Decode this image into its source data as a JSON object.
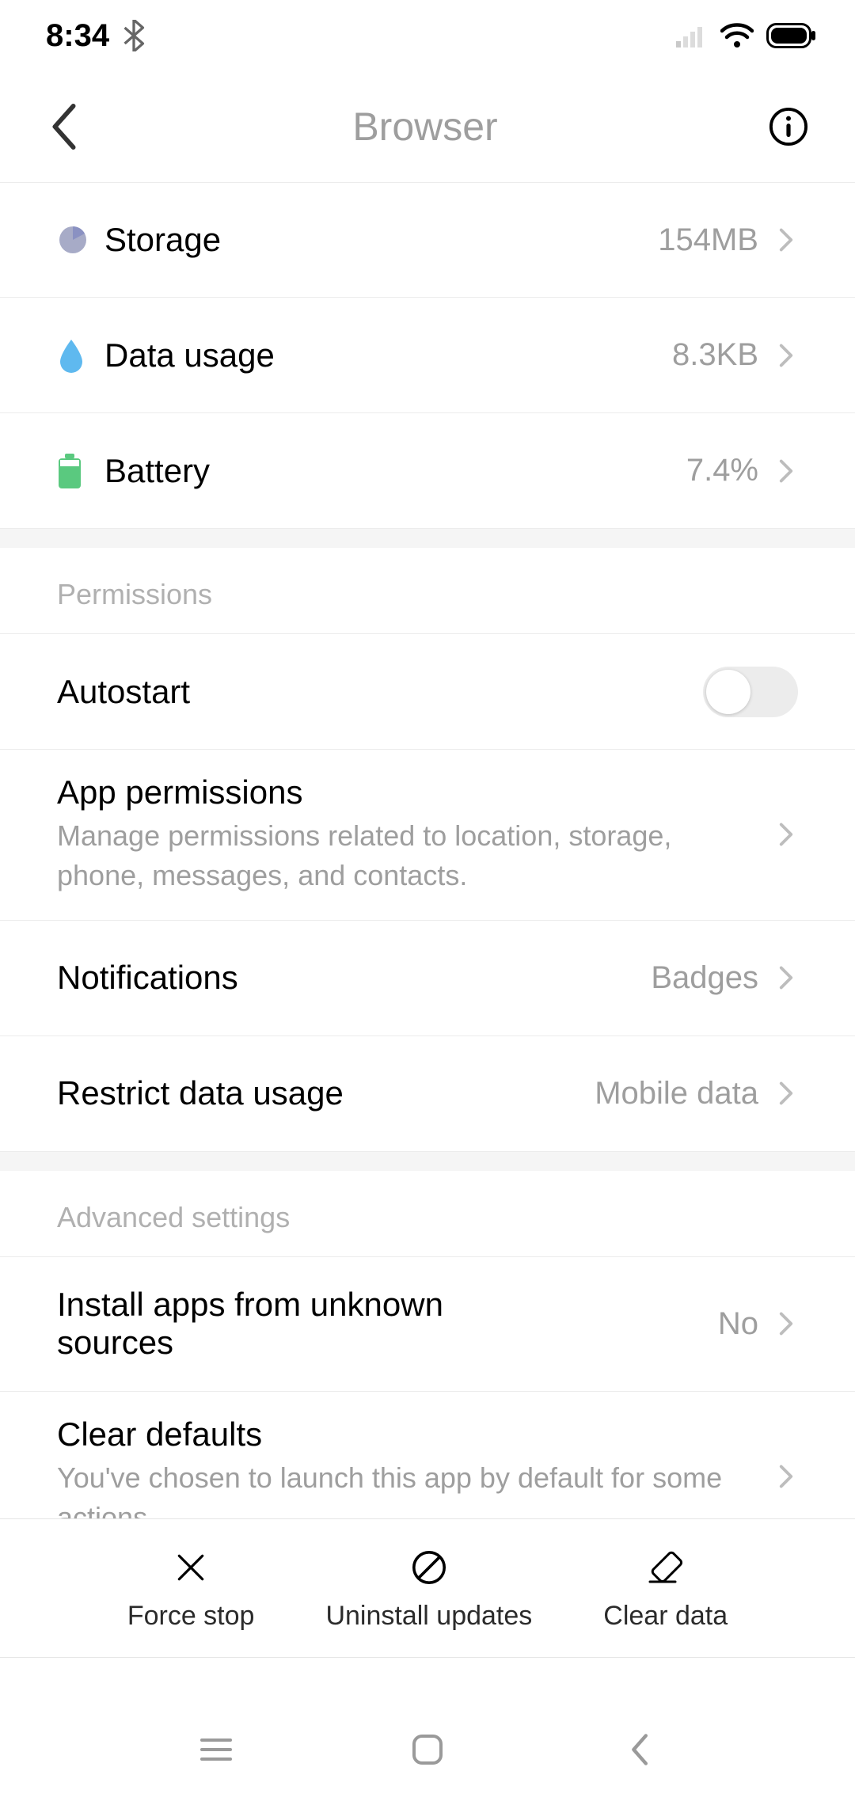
{
  "status": {
    "time": "8:34"
  },
  "header": {
    "title": "Browser"
  },
  "usage": {
    "storage": {
      "label": "Storage",
      "value": "154MB"
    },
    "data": {
      "label": "Data usage",
      "value": "8.3KB"
    },
    "battery": {
      "label": "Battery",
      "value": "7.4%"
    }
  },
  "permissions": {
    "header": "Permissions",
    "autostart": {
      "label": "Autostart"
    },
    "app_perms": {
      "label": "App permissions",
      "sub": "Manage permissions related to location, storage, phone, messages, and contacts."
    },
    "notifications": {
      "label": "Notifications",
      "value": "Badges"
    },
    "restrict": {
      "label": "Restrict data usage",
      "value": "Mobile data"
    }
  },
  "advanced": {
    "header": "Advanced settings",
    "unknown": {
      "label": "Install apps from unknown sources",
      "value": "No"
    },
    "clear_defaults": {
      "label": "Clear defaults",
      "sub": "You've chosen to launch this app by default for some actions."
    }
  },
  "actions": {
    "force_stop": "Force stop",
    "uninstall": "Uninstall updates",
    "clear_data": "Clear data"
  }
}
